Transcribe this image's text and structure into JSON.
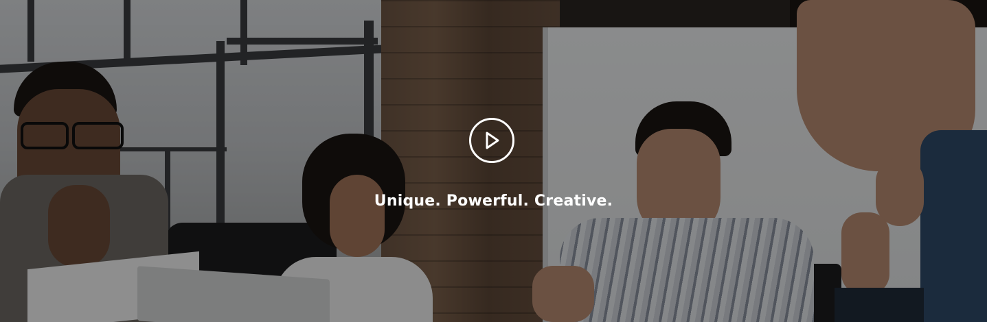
{
  "hero": {
    "tagline": "Unique. Powerful. Creative.",
    "play_icon": "play-circle-icon",
    "overlay_color": "#000000",
    "text_color": "#ffffff"
  }
}
